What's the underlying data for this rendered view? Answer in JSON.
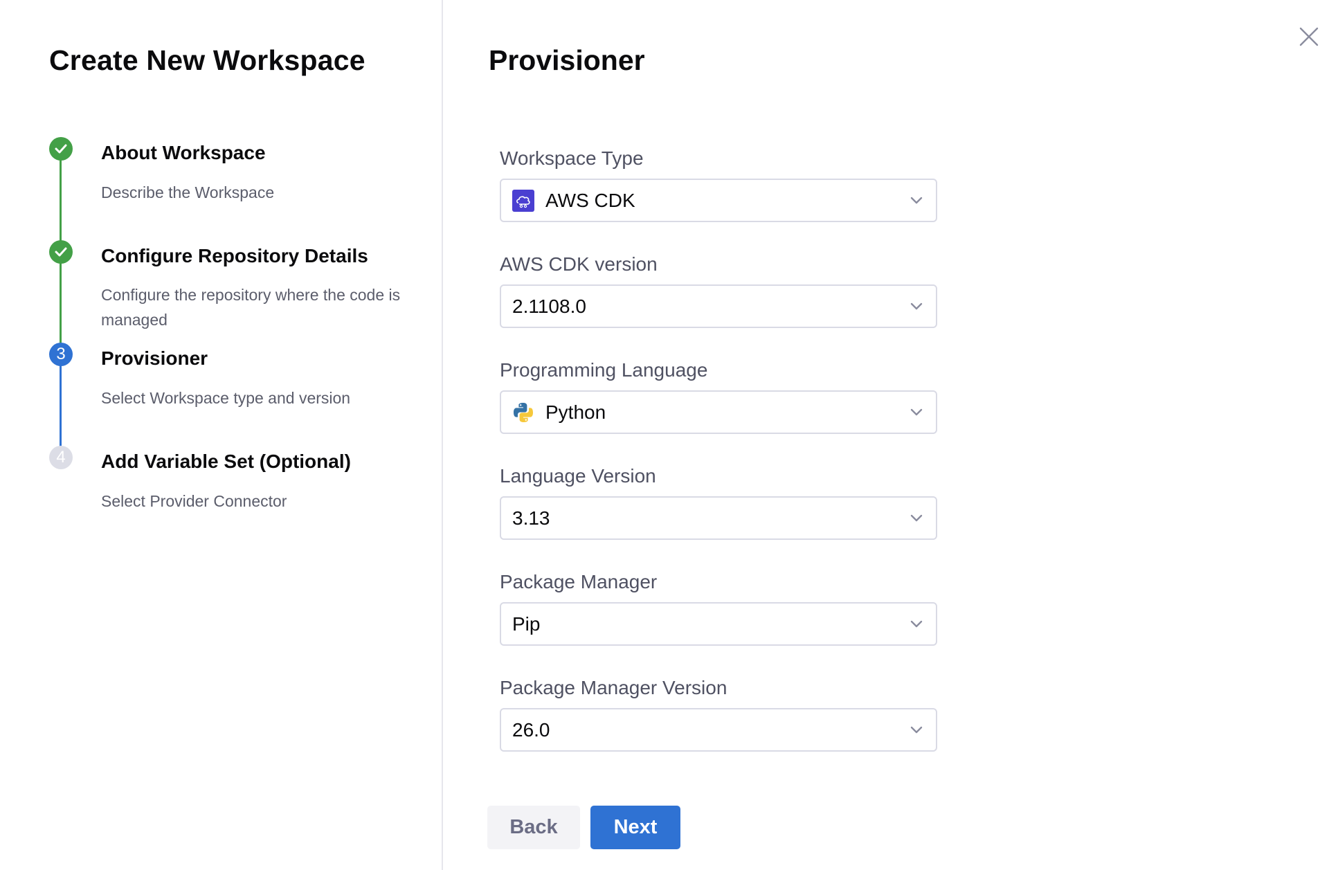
{
  "wizard": {
    "title": "Create New Workspace",
    "steps": [
      {
        "number": "1",
        "status": "completed",
        "title": "About Workspace",
        "description": "Describe the Workspace"
      },
      {
        "number": "2",
        "status": "completed",
        "title": "Configure Repository Details",
        "description": "Configure the repository where the code is managed"
      },
      {
        "number": "3",
        "status": "active",
        "title": "Provisioner",
        "description": "Select Workspace type and version"
      },
      {
        "number": "4",
        "status": "pending",
        "title": "Add Variable Set (Optional)",
        "description": "Select Provider Connector"
      }
    ]
  },
  "panel": {
    "title": "Provisioner",
    "close_icon": "close-icon"
  },
  "form": {
    "fields": [
      {
        "label": "Workspace Type",
        "value": "AWS CDK",
        "icon": "aws-cdk-icon"
      },
      {
        "label": "AWS CDK version",
        "value": "2.1108.0"
      },
      {
        "label": "Programming Language",
        "value": "Python",
        "icon": "python-icon"
      },
      {
        "label": "Language Version",
        "value": "3.13"
      },
      {
        "label": "Package Manager",
        "value": "Pip"
      },
      {
        "label": "Package Manager Version",
        "value": "26.0"
      }
    ]
  },
  "actions": {
    "back_label": "Back",
    "next_label": "Next"
  },
  "colors": {
    "completed": "#43a047",
    "active": "#2f72d3",
    "pending": "#d9dae5",
    "primary_button": "#2f72d3"
  }
}
